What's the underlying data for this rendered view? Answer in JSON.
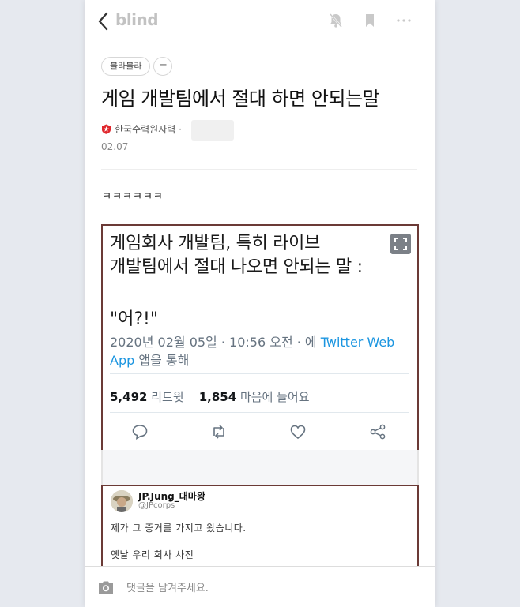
{
  "app": {
    "brand": "blind"
  },
  "post": {
    "tag": "블라블라",
    "tag_remove": "−",
    "title": "게임 개발팀에서 절대 하면 안되는말",
    "company": "한국수력원자력",
    "separator": "·",
    "date": "02.07",
    "body": "ㅋㅋㅋㅋㅋㅋ"
  },
  "tweet": {
    "text": "게임회사 개발팀, 특히 라이브\n개발팀에서 절대 나오면 안되는 말 :",
    "quote": "\"어?!\"",
    "meta_prefix": "2020년 02월 05일 · 10:56 오전 · 에 ",
    "meta_link": "Twitter Web App",
    "meta_suffix": " 앱을 통해",
    "retweets": "5,492",
    "retweets_label": "리트윗",
    "likes": "1,854",
    "likes_label": "마음에 들어요"
  },
  "reply": {
    "name": "JP.Jung_대마왕",
    "handle": "@JPcorps",
    "line1": "제가 그 증거를 가지고 왔습니다.",
    "line2": "옛날 우리 회사 사진"
  },
  "comment": {
    "placeholder": "댓글을 남겨주세요."
  },
  "colors": {
    "accent_border": "#6b3a36",
    "twitter_link": "#1b95e0",
    "company_red": "#e0282e"
  },
  "icons": [
    "back-icon",
    "bell-off-icon",
    "bookmark-icon",
    "more-icon",
    "company-logo-icon",
    "expand-icon",
    "reply-icon",
    "retweet-icon",
    "heart-icon",
    "share-icon",
    "camera-icon"
  ]
}
